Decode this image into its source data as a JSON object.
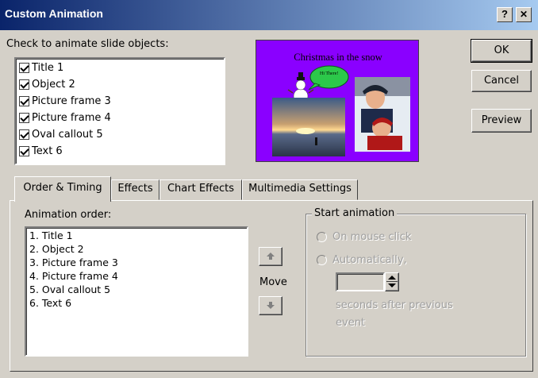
{
  "window": {
    "title": "Custom Animation",
    "help_label": "?",
    "close_label": "✕"
  },
  "objects_section": {
    "label": "Check to animate slide objects:",
    "items": [
      {
        "label": "Title 1",
        "checked": true
      },
      {
        "label": "Object 2",
        "checked": true
      },
      {
        "label": "Picture frame 3",
        "checked": true
      },
      {
        "label": "Picture frame 4",
        "checked": true
      },
      {
        "label": "Oval callout 5",
        "checked": true
      },
      {
        "label": "Text 6",
        "checked": true
      }
    ]
  },
  "slide_preview": {
    "title": "Christmas in the snow",
    "callout_text": "Hi There!",
    "background_color": "#8a00ff"
  },
  "buttons": {
    "ok": "OK",
    "cancel": "Cancel",
    "preview": "Preview"
  },
  "tabs": [
    {
      "label": "Order & Timing",
      "active": true
    },
    {
      "label": "Effects",
      "active": false
    },
    {
      "label": "Chart Effects",
      "active": false
    },
    {
      "label": "Multimedia Settings",
      "active": false
    }
  ],
  "order_timing": {
    "animation_order_label": "Animation order:",
    "order_items": [
      "1. Title 1",
      "2. Object 2",
      "3. Picture frame 3",
      "4. Picture frame 4",
      "5. Oval callout 5",
      "6. Text 6"
    ],
    "move_label": "Move",
    "start_animation": {
      "group_label": "Start animation",
      "on_mouse_click": "On mouse click",
      "automatically": "Automatically,",
      "seconds_text": "seconds after previous",
      "event_text": "event"
    }
  }
}
